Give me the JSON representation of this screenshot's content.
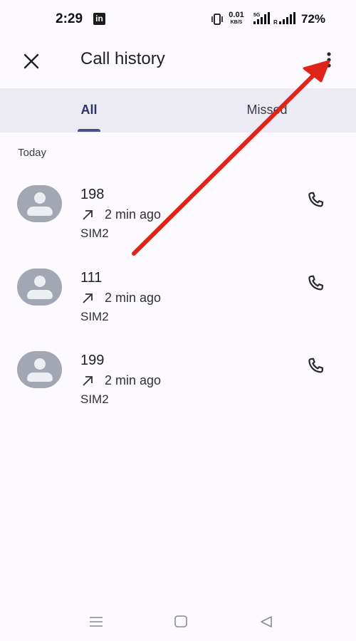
{
  "status_bar": {
    "time": "2:29",
    "linkedin_label": "in",
    "net_speed_value": "0.01",
    "net_speed_unit": "KB/S",
    "network_5g": "5G",
    "roaming": "R",
    "battery": "72%"
  },
  "app_bar": {
    "title": "Call history",
    "close_icon": "close-icon",
    "more_icon": "more-vert-icon"
  },
  "tabs": [
    {
      "label": "All",
      "selected": true
    },
    {
      "label": "Missed",
      "selected": false
    }
  ],
  "section": {
    "header": "Today"
  },
  "calls": [
    {
      "number": "198",
      "direction": "outgoing",
      "time": "2 min ago",
      "sim": "SIM2"
    },
    {
      "number": "111",
      "direction": "outgoing",
      "time": "2 min ago",
      "sim": "SIM2"
    },
    {
      "number": "199",
      "direction": "outgoing",
      "time": "2 min ago",
      "sim": "SIM2"
    }
  ],
  "nav_bar": {
    "recents_icon": "recents-icon",
    "home_icon": "home-icon",
    "back_icon": "back-icon"
  },
  "colors": {
    "background": "#FCFAFE",
    "tab_bar": "#ECEBF3",
    "tab_selected": "#2E3266",
    "indicator": "#4B4F8C",
    "avatar": "#A3A6B3",
    "annotation_arrow": "#E02418"
  }
}
